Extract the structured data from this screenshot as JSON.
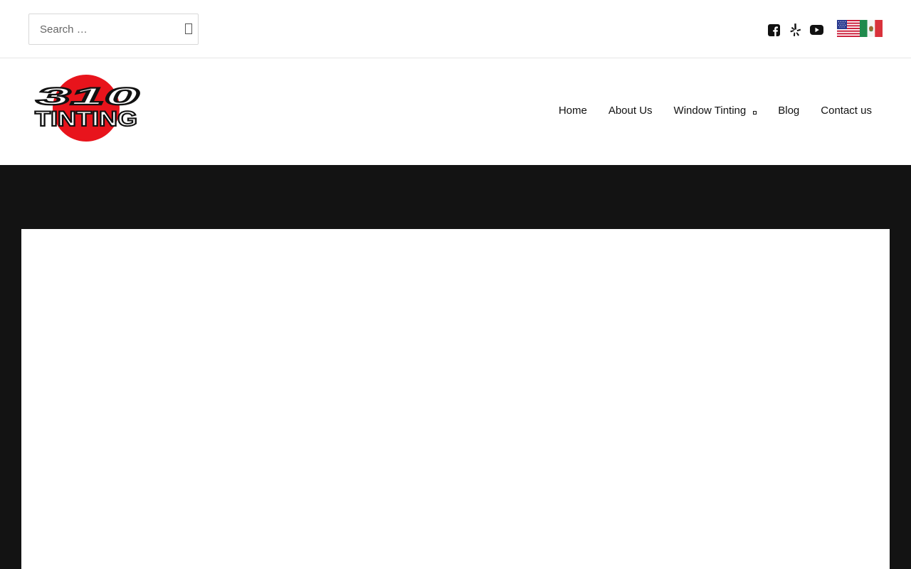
{
  "search": {
    "placeholder": "Search …",
    "value": ""
  },
  "social": [
    {
      "name": "facebook-icon"
    },
    {
      "name": "yelp-icon"
    },
    {
      "name": "youtube-icon"
    }
  ],
  "languages": [
    {
      "name": "English",
      "flag": "us-flag-icon"
    },
    {
      "name": "Spanish",
      "flag": "mexico-flag-icon"
    }
  ],
  "logo": {
    "line1": "310",
    "line2": "TINTING"
  },
  "nav": {
    "items": [
      {
        "label": "Home"
      },
      {
        "label": "About Us"
      },
      {
        "label": "Window Tinting",
        "has_dropdown": true
      },
      {
        "label": "Blog"
      },
      {
        "label": "Contact us"
      }
    ]
  },
  "colors": {
    "hero_bg": "#131313",
    "logo_red": "#e8141c",
    "text": "#111111"
  }
}
